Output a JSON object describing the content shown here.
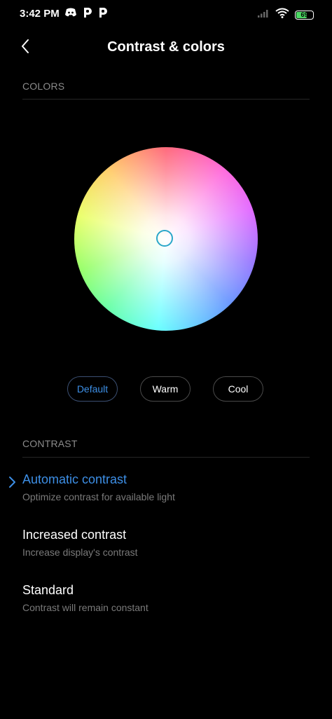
{
  "status_bar": {
    "time": "3:42 PM",
    "battery_level": "69",
    "battery_fraction": 0.69,
    "notification_icons": [
      "discord-icon",
      "p-icon",
      "p-icon"
    ]
  },
  "header": {
    "title": "Contrast & colors"
  },
  "colors_section": {
    "header": "COLORS",
    "presets": [
      {
        "label": "Default",
        "selected": true
      },
      {
        "label": "Warm",
        "selected": false
      },
      {
        "label": "Cool",
        "selected": false
      }
    ]
  },
  "contrast_section": {
    "header": "CONTRAST",
    "options": [
      {
        "title": "Automatic contrast",
        "subtitle": "Optimize contrast for available light",
        "selected": true
      },
      {
        "title": "Increased contrast",
        "subtitle": "Increase display's contrast",
        "selected": false
      },
      {
        "title": "Standard",
        "subtitle": "Contrast will remain constant",
        "selected": false
      }
    ]
  },
  "colors": {
    "accent": "#3d8fe6",
    "background": "#000000",
    "battery_green": "#4cd964",
    "secondary_text": "#7a7a7a"
  }
}
